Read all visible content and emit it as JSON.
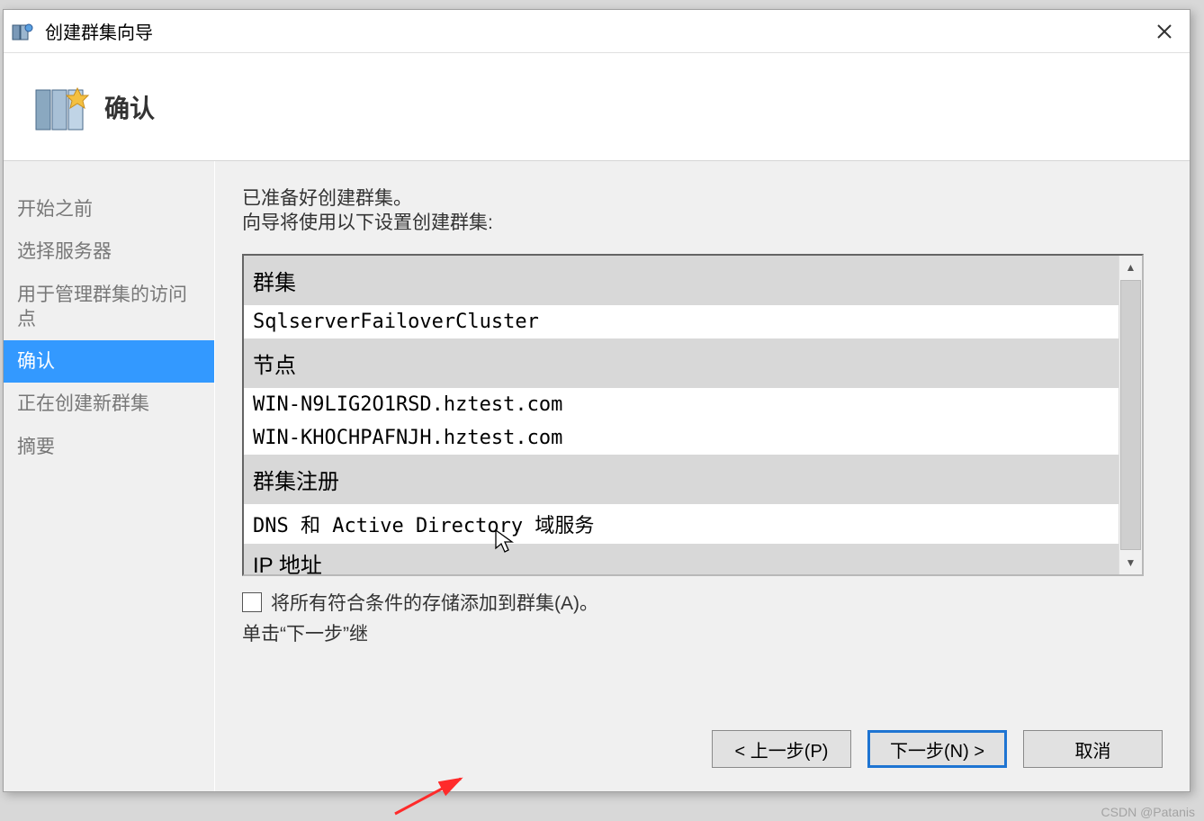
{
  "window": {
    "title": "创建群集向导"
  },
  "header": {
    "title": "确认"
  },
  "sidebar": {
    "steps": [
      "开始之前",
      "选择服务器",
      "用于管理群集的访问点",
      "确认",
      "正在创建新群集",
      "摘要"
    ],
    "active_index": 3
  },
  "main": {
    "intro_line1": "已准备好创建群集。",
    "intro_line2": "向导将使用以下设置创建群集:",
    "rows": [
      {
        "type": "head",
        "text": "群集"
      },
      {
        "type": "value",
        "text": "SqlserverFailoverCluster"
      },
      {
        "type": "head",
        "text": "节点"
      },
      {
        "type": "value",
        "text": "WIN-N9LIG2O1RSD.hztest.com"
      },
      {
        "type": "value",
        "text": "WIN-KHOCHPAFNJH.hztest.com"
      },
      {
        "type": "head",
        "text": "群集注册"
      },
      {
        "type": "value",
        "text": "DNS 和 Active Directory 域服务"
      },
      {
        "type": "head",
        "text": "IP 地址"
      }
    ],
    "checkbox_label": "将所有符合条件的存储添加到群集(A)。",
    "hint": "单击“下一步”继"
  },
  "buttons": {
    "prev": "< 上一步(P)",
    "next": "下一步(N) >",
    "cancel": "取消"
  },
  "watermark": "CSDN @Patanis"
}
